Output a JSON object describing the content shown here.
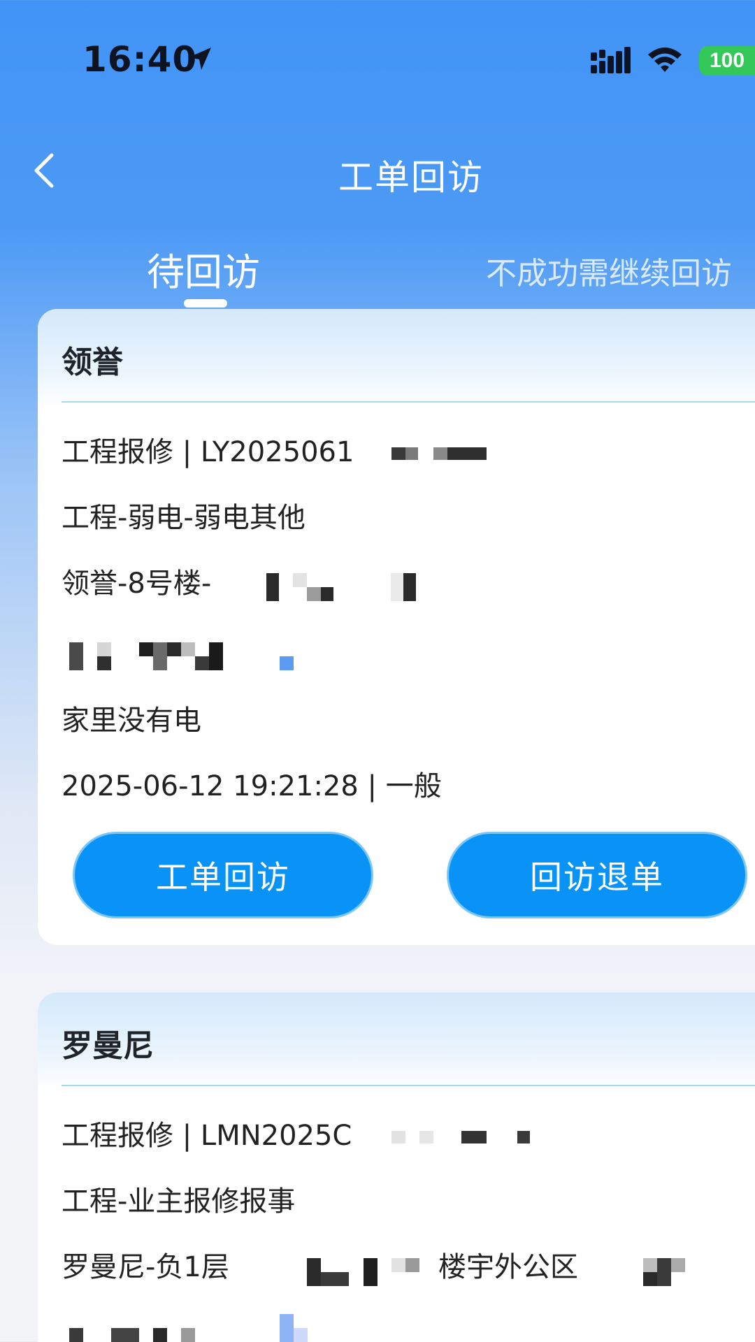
{
  "status_bar": {
    "time": "16:40",
    "battery": "100",
    "icons": [
      "location-arrow-icon",
      "signal-icon",
      "wifi-icon",
      "battery-icon"
    ]
  },
  "nav": {
    "title": "工单回访",
    "back_icon": "chevron-left-icon"
  },
  "tabs": [
    {
      "label": "待回访",
      "active": true
    },
    {
      "label": "不成功需继续回访",
      "active": false
    }
  ],
  "cards": [
    {
      "project": "领誉",
      "order_line": "工程报修 | LY2025061",
      "category": "工程-弱电-弱电其他",
      "location": "领誉-8号楼-",
      "description": "家里没有电",
      "meta": "2025-06-12 19:21:28 | 一般",
      "actions": {
        "visit": "工单回访",
        "return": "回访退单"
      }
    },
    {
      "project": "罗曼尼",
      "order_line": "工程报修 | LMN2025C",
      "category": "工程-业主报修报事",
      "location": "罗曼尼-负1层",
      "location_extra": "楼宇外公区"
    }
  ],
  "colors": {
    "header_blue": "#4194f6",
    "button_blue": "#0a93f7",
    "battery_green": "#34c759",
    "divider": "#a9dbe8"
  }
}
